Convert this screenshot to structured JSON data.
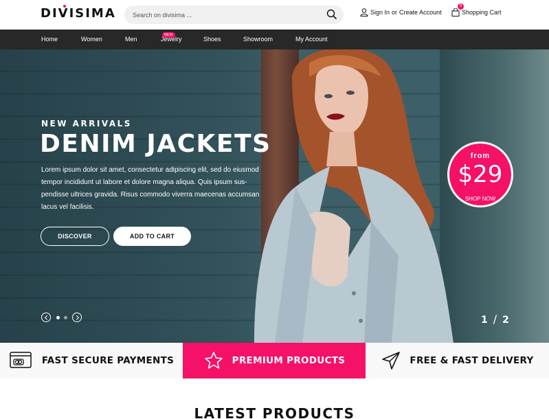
{
  "header": {
    "logo": "DIVISIMA",
    "search_placeholder": "Search on divisima ...",
    "sign_in": "Sign In",
    "or_text": "or",
    "create_account": "Create Account",
    "cart_label": "Shopping Cart",
    "cart_count": "0"
  },
  "nav": {
    "items": [
      {
        "label": "Home"
      },
      {
        "label": "Women"
      },
      {
        "label": "Men"
      },
      {
        "label": "Jewelry",
        "badge": "NEW"
      },
      {
        "label": "Shoes"
      },
      {
        "label": "Showroom"
      },
      {
        "label": "My Account"
      }
    ]
  },
  "hero": {
    "subtitle": "NEW ARRIVALS",
    "title": "DENIM JACKETS",
    "text": "Lorem ipsum dolor sit amet, consectetur adipiscing elit, sed do eiusmod tempor incididunt ut labore et dolore magna aliqua. Quis ipsum sus-pendisse ultrices gravida. Risus commodo viverra maecenas accumsan lacus vel facilisis.",
    "discover_label": "DISCOVER",
    "add_to_cart_label": "ADD TO CART",
    "price_from": "from",
    "price_amount": "$29",
    "shop_now": "SHOP NOW",
    "slide_current": "1",
    "slide_total": "2"
  },
  "features": [
    {
      "label": "FAST SECURE PAYMENTS",
      "icon": "credit-card-icon"
    },
    {
      "label": "PREMIUM PRODUCTS",
      "icon": "star-icon"
    },
    {
      "label": "FREE & FAST DELIVERY",
      "icon": "paper-plane-icon"
    }
  ],
  "section_title": "LATEST PRODUCTS",
  "colors": {
    "accent": "#f51167",
    "nav_bg": "#282828",
    "feature_bg": "#f8f8f8"
  }
}
